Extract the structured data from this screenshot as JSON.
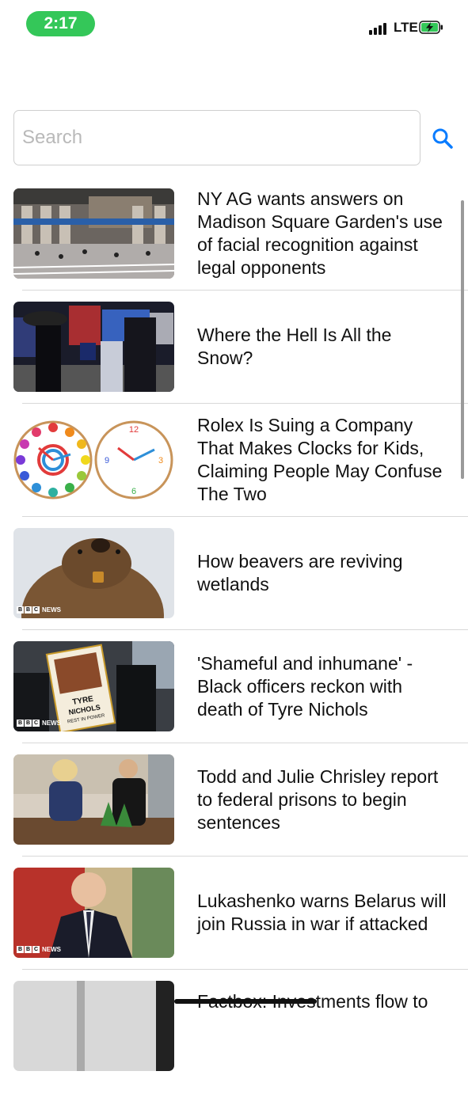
{
  "status_bar": {
    "time": "2:17",
    "network": "LTE"
  },
  "search": {
    "placeholder": "Search",
    "value": ""
  },
  "articles": [
    {
      "headline": "NY AG wants answers on Madison Square Garden's use of facial recognition against legal opponents",
      "source_badge": ""
    },
    {
      "headline": "Where the Hell Is All the Snow?",
      "source_badge": ""
    },
    {
      "headline": "Rolex Is Suing a Company That Makes Clocks for Kids, Claiming People May Confuse The Two",
      "source_badge": ""
    },
    {
      "headline": "How beavers are reviving wetlands",
      "source_badge": "BBC NEWS"
    },
    {
      "headline": "'Shameful and inhumane' - Black officers reckon with death of Tyre Nichols",
      "source_badge": "BBC NEWS",
      "image_text": "TYRE NICHOLS REST IN POWER"
    },
    {
      "headline": "Todd and Julie Chrisley report to federal prisons to begin sentences",
      "source_badge": ""
    },
    {
      "headline": "Lukashenko warns Belarus will join Russia in war if attacked",
      "source_badge": "BBC NEWS"
    },
    {
      "headline": "Factbox: Investments flow to",
      "source_badge": ""
    }
  ],
  "colors": {
    "accent": "#0a7cff",
    "status_green": "#34c759"
  }
}
